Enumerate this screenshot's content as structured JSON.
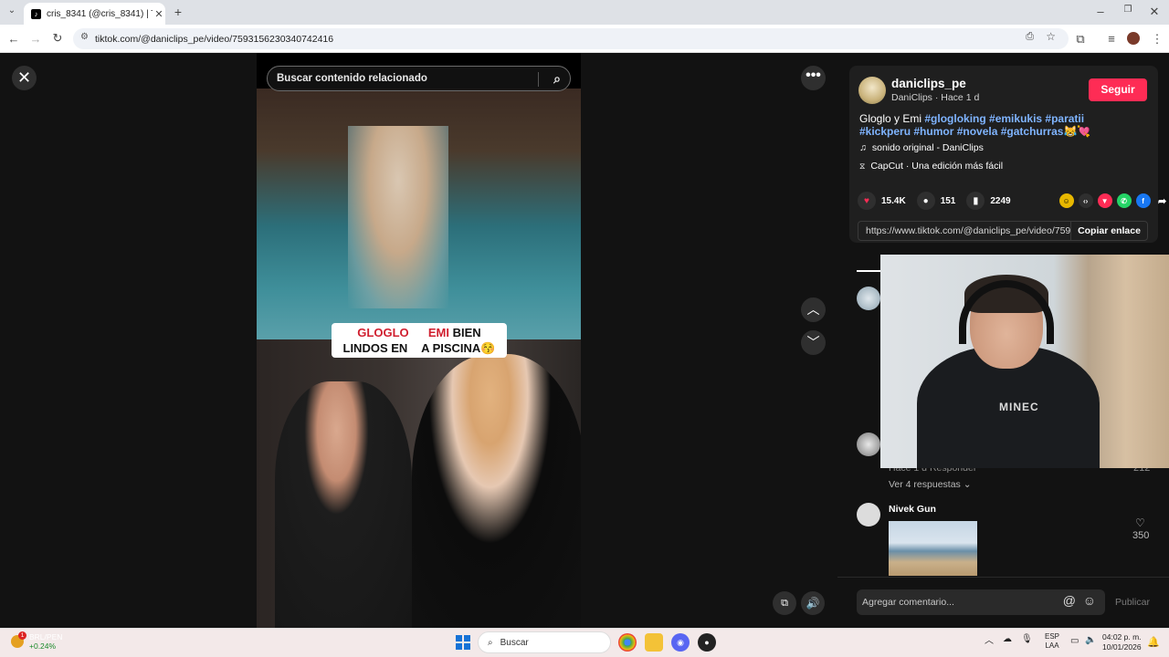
{
  "browser": {
    "tab_title": "cris_8341 (@cris_8341) | TikTok",
    "url": "tiktok.com/@daniclips_pe/video/7593156230340742416"
  },
  "player": {
    "search_placeholder": "Buscar contenido relacionado",
    "caption_line1_red1": "GLOGLO",
    "caption_line1_red2": "EMI",
    "caption_line1_black": "BIEN",
    "caption_line2_a": "LINDOS EN",
    "caption_line2_b": "A PISCINA",
    "caption_emoji": "😚"
  },
  "post": {
    "author_name": "daniclips_pe",
    "author_sub": "DaniClips · Hace 1 d",
    "follow_label": "Seguir",
    "description_text": "Gloglo y Emi",
    "description_tags": "#glogloking #emikukis #paratii #kickperu #humor #novela #gatchurras",
    "description_emoji": "😹💘",
    "sound": "sonido original - DaniClips",
    "capcut": "CapCut · Una edición más fácil",
    "likes": "15.4K",
    "comments": "151",
    "saves": "2249",
    "share_url": "https://www.tiktok.com/@daniclips_pe/video/7593...",
    "copy_link_label": "Copiar enlace"
  },
  "comments": {
    "comment1_meta": "Hace 1 d    Responder",
    "comment1_likes": "212",
    "view_replies": "Ver 4 respuestas",
    "comment2_author": "Nivek Gun",
    "comment2_likes": "350",
    "input_placeholder": "Agregar comentario...",
    "publish_label": "Publicar"
  },
  "webcam": {
    "shirt_text": "MINEC"
  },
  "taskbar": {
    "ticker_symbol": "BRL/PEN",
    "ticker_change": "+0.24%",
    "ticker_badge": "1",
    "search_placeholder": "Buscar",
    "lang_top": "ESP",
    "lang_bottom": "LAA",
    "time": "04:02 p. m.",
    "date": "10/01/2026"
  },
  "colors": {
    "accent_follow": "#fe2c55",
    "hashtag": "#7fb4ff",
    "background": "#121212"
  }
}
